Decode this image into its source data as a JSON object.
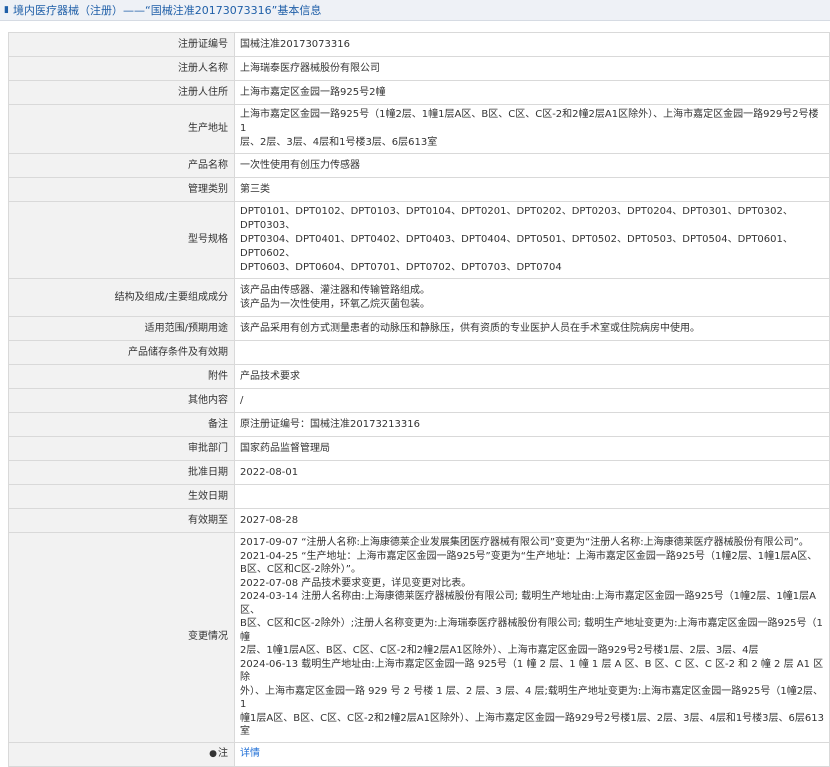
{
  "breadcrumb": {
    "text": "境内医疗器械（注册）——“国械注准20173073316”基本信息"
  },
  "rows": {
    "reg_no": {
      "label": "注册证编号",
      "value": "国械注准20173073316"
    },
    "registrant": {
      "label": "注册人名称",
      "value": "上海瑞泰医疗器械股份有限公司"
    },
    "address": {
      "label": "注册人住所",
      "value": "上海市嘉定区金园一路925号2幢"
    },
    "prod_address": {
      "label": "生产地址",
      "lines": [
        "上海市嘉定区金园一路925号（1幢2层、1幢1层A区、B区、C区、C区-2和2幢2层A1区除外）、上海市嘉定区金园一路929号2号楼1",
        "层、2层、3层、4层和1号楼3层、6层613室"
      ]
    },
    "product_name": {
      "label": "产品名称",
      "value": "一次性使用有创压力传感器"
    },
    "category": {
      "label": "管理类别",
      "value": "第三类"
    },
    "models": {
      "label": "型号规格",
      "lines": [
        "DPT0101、DPT0102、DPT0103、DPT0104、DPT0201、DPT0202、DPT0203、DPT0204、DPT0301、DPT0302、DPT0303、",
        "DPT0304、DPT0401、DPT0402、DPT0403、DPT0404、DPT0501、DPT0502、DPT0503、DPT0504、DPT0601、DPT0602、",
        "DPT0603、DPT0604、DPT0701、DPT0702、DPT0703、DPT0704"
      ]
    },
    "composition": {
      "label": "结构及组成/主要组成成分",
      "lines": [
        "该产品由传感器、灌注器和传输管路组成。",
        "该产品为一次性使用，环氧乙烷灭菌包装。"
      ]
    },
    "scope": {
      "label": "适用范围/预期用途",
      "value": "该产品采用有创方式测量患者的动脉压和静脉压，供有资质的专业医护人员在手术室或住院病房中使用。"
    },
    "storage": {
      "label": "产品储存条件及有效期",
      "value": ""
    },
    "attachment": {
      "label": "附件",
      "value": "产品技术要求"
    },
    "other": {
      "label": "其他内容",
      "value": "/"
    },
    "remark": {
      "label": "备注",
      "value": "原注册证编号：国械注准20173213316"
    },
    "dept": {
      "label": "审批部门",
      "value": "国家药品监督管理局"
    },
    "approval_date": {
      "label": "批准日期",
      "value": "2022-08-01"
    },
    "effective_date": {
      "label": "生效日期",
      "value": ""
    },
    "expiry": {
      "label": "有效期至",
      "value": "2027-08-28"
    },
    "changes": {
      "label": "变更情况",
      "lines": [
        "2017-09-07 “注册人名称:上海康德莱企业发展集团医疗器械有限公司”变更为“注册人名称:上海康德莱医疗器械股份有限公司”。",
        "2021-04-25 “生产地址：上海市嘉定区金园一路925号”变更为“生产地址：上海市嘉定区金园一路925号（1幢2层、1幢1层A区、",
        "B区、C区和C区-2除外）”。",
        "2022-07-08 产品技术要求变更，详见变更对比表。",
        "2024-03-14 注册人名称由:上海康德莱医疗器械股份有限公司; 载明生产地址由:上海市嘉定区金园一路925号（1幢2层、1幢1层A区、",
        "B区、C区和C区-2除外）;注册人名称变更为:上海瑞泰医疗器械股份有限公司; 载明生产地址变更为:上海市嘉定区金园一路925号（1幢",
        "2层、1幢1层A区、B区、C区、C区-2和2幢2层A1区除外）、上海市嘉定区金园一路929号2号楼1层、2层、3层、4层",
        "2024-06-13 载明生产地址由:上海市嘉定区金园一路 925号（1 幢 2 层、1 幢 1 层 A 区、B 区、C 区、C 区-2 和 2 幢 2 层 A1 区除",
        "外）、上海市嘉定区金园一路 929 号 2 号楼 1 层、2 层、3 层、4 层;载明生产地址变更为:上海市嘉定区金园一路925号（1幢2层、1",
        "幢1层A区、B区、C区、C区-2和2幢2层A1区除外）、上海市嘉定区金园一路929号2号楼1层、2层、3层、4层和1号楼3层、6层613",
        "室"
      ]
    },
    "note": {
      "label": "注",
      "icon": "lightbulb-icon",
      "link": "详情"
    }
  },
  "colors": {
    "label_bg": "#f2f2f2",
    "border": "#d9d9d9",
    "link": "#1f6fd6",
    "breadcrumb": "#1f5fa8"
  }
}
